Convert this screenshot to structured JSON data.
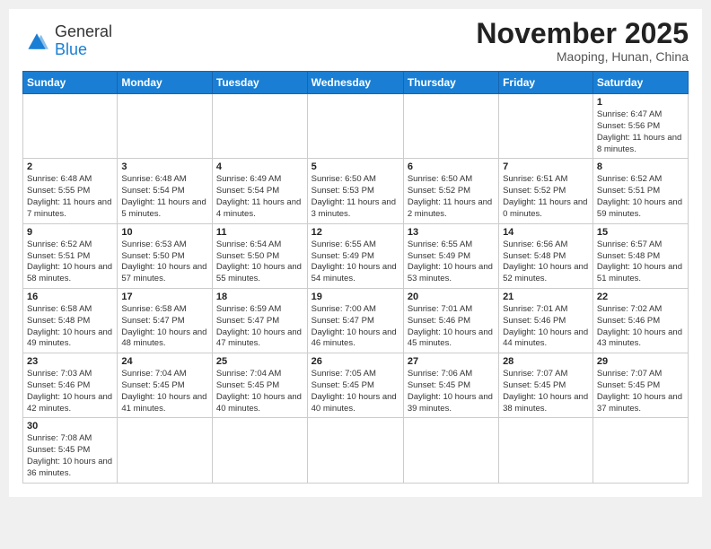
{
  "header": {
    "logo_general": "General",
    "logo_blue": "Blue",
    "month_title": "November 2025",
    "location": "Maoping, Hunan, China"
  },
  "days_of_week": [
    "Sunday",
    "Monday",
    "Tuesday",
    "Wednesday",
    "Thursday",
    "Friday",
    "Saturday"
  ],
  "weeks": [
    [
      {
        "day": "",
        "info": ""
      },
      {
        "day": "",
        "info": ""
      },
      {
        "day": "",
        "info": ""
      },
      {
        "day": "",
        "info": ""
      },
      {
        "day": "",
        "info": ""
      },
      {
        "day": "",
        "info": ""
      },
      {
        "day": "1",
        "info": "Sunrise: 6:47 AM\nSunset: 5:56 PM\nDaylight: 11 hours and 8 minutes."
      }
    ],
    [
      {
        "day": "2",
        "info": "Sunrise: 6:48 AM\nSunset: 5:55 PM\nDaylight: 11 hours and 7 minutes."
      },
      {
        "day": "3",
        "info": "Sunrise: 6:48 AM\nSunset: 5:54 PM\nDaylight: 11 hours and 5 minutes."
      },
      {
        "day": "4",
        "info": "Sunrise: 6:49 AM\nSunset: 5:54 PM\nDaylight: 11 hours and 4 minutes."
      },
      {
        "day": "5",
        "info": "Sunrise: 6:50 AM\nSunset: 5:53 PM\nDaylight: 11 hours and 3 minutes."
      },
      {
        "day": "6",
        "info": "Sunrise: 6:50 AM\nSunset: 5:52 PM\nDaylight: 11 hours and 2 minutes."
      },
      {
        "day": "7",
        "info": "Sunrise: 6:51 AM\nSunset: 5:52 PM\nDaylight: 11 hours and 0 minutes."
      },
      {
        "day": "8",
        "info": "Sunrise: 6:52 AM\nSunset: 5:51 PM\nDaylight: 10 hours and 59 minutes."
      }
    ],
    [
      {
        "day": "9",
        "info": "Sunrise: 6:52 AM\nSunset: 5:51 PM\nDaylight: 10 hours and 58 minutes."
      },
      {
        "day": "10",
        "info": "Sunrise: 6:53 AM\nSunset: 5:50 PM\nDaylight: 10 hours and 57 minutes."
      },
      {
        "day": "11",
        "info": "Sunrise: 6:54 AM\nSunset: 5:50 PM\nDaylight: 10 hours and 55 minutes."
      },
      {
        "day": "12",
        "info": "Sunrise: 6:55 AM\nSunset: 5:49 PM\nDaylight: 10 hours and 54 minutes."
      },
      {
        "day": "13",
        "info": "Sunrise: 6:55 AM\nSunset: 5:49 PM\nDaylight: 10 hours and 53 minutes."
      },
      {
        "day": "14",
        "info": "Sunrise: 6:56 AM\nSunset: 5:48 PM\nDaylight: 10 hours and 52 minutes."
      },
      {
        "day": "15",
        "info": "Sunrise: 6:57 AM\nSunset: 5:48 PM\nDaylight: 10 hours and 51 minutes."
      }
    ],
    [
      {
        "day": "16",
        "info": "Sunrise: 6:58 AM\nSunset: 5:48 PM\nDaylight: 10 hours and 49 minutes."
      },
      {
        "day": "17",
        "info": "Sunrise: 6:58 AM\nSunset: 5:47 PM\nDaylight: 10 hours and 48 minutes."
      },
      {
        "day": "18",
        "info": "Sunrise: 6:59 AM\nSunset: 5:47 PM\nDaylight: 10 hours and 47 minutes."
      },
      {
        "day": "19",
        "info": "Sunrise: 7:00 AM\nSunset: 5:47 PM\nDaylight: 10 hours and 46 minutes."
      },
      {
        "day": "20",
        "info": "Sunrise: 7:01 AM\nSunset: 5:46 PM\nDaylight: 10 hours and 45 minutes."
      },
      {
        "day": "21",
        "info": "Sunrise: 7:01 AM\nSunset: 5:46 PM\nDaylight: 10 hours and 44 minutes."
      },
      {
        "day": "22",
        "info": "Sunrise: 7:02 AM\nSunset: 5:46 PM\nDaylight: 10 hours and 43 minutes."
      }
    ],
    [
      {
        "day": "23",
        "info": "Sunrise: 7:03 AM\nSunset: 5:46 PM\nDaylight: 10 hours and 42 minutes."
      },
      {
        "day": "24",
        "info": "Sunrise: 7:04 AM\nSunset: 5:45 PM\nDaylight: 10 hours and 41 minutes."
      },
      {
        "day": "25",
        "info": "Sunrise: 7:04 AM\nSunset: 5:45 PM\nDaylight: 10 hours and 40 minutes."
      },
      {
        "day": "26",
        "info": "Sunrise: 7:05 AM\nSunset: 5:45 PM\nDaylight: 10 hours and 40 minutes."
      },
      {
        "day": "27",
        "info": "Sunrise: 7:06 AM\nSunset: 5:45 PM\nDaylight: 10 hours and 39 minutes."
      },
      {
        "day": "28",
        "info": "Sunrise: 7:07 AM\nSunset: 5:45 PM\nDaylight: 10 hours and 38 minutes."
      },
      {
        "day": "29",
        "info": "Sunrise: 7:07 AM\nSunset: 5:45 PM\nDaylight: 10 hours and 37 minutes."
      }
    ],
    [
      {
        "day": "30",
        "info": "Sunrise: 7:08 AM\nSunset: 5:45 PM\nDaylight: 10 hours and 36 minutes."
      },
      {
        "day": "",
        "info": ""
      },
      {
        "day": "",
        "info": ""
      },
      {
        "day": "",
        "info": ""
      },
      {
        "day": "",
        "info": ""
      },
      {
        "day": "",
        "info": ""
      },
      {
        "day": "",
        "info": ""
      }
    ]
  ]
}
